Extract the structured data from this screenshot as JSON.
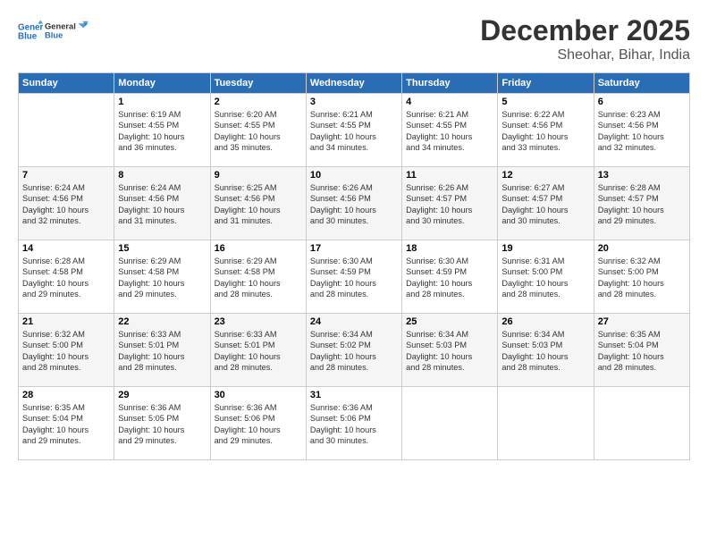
{
  "logo": {
    "line1": "General",
    "line2": "Blue"
  },
  "title": "December 2025",
  "subtitle": "Sheohar, Bihar, India",
  "header": {
    "days": [
      "Sunday",
      "Monday",
      "Tuesday",
      "Wednesday",
      "Thursday",
      "Friday",
      "Saturday"
    ]
  },
  "weeks": [
    [
      {
        "num": "",
        "info": ""
      },
      {
        "num": "1",
        "info": "Sunrise: 6:19 AM\nSunset: 4:55 PM\nDaylight: 10 hours\nand 36 minutes."
      },
      {
        "num": "2",
        "info": "Sunrise: 6:20 AM\nSunset: 4:55 PM\nDaylight: 10 hours\nand 35 minutes."
      },
      {
        "num": "3",
        "info": "Sunrise: 6:21 AM\nSunset: 4:55 PM\nDaylight: 10 hours\nand 34 minutes."
      },
      {
        "num": "4",
        "info": "Sunrise: 6:21 AM\nSunset: 4:55 PM\nDaylight: 10 hours\nand 34 minutes."
      },
      {
        "num": "5",
        "info": "Sunrise: 6:22 AM\nSunset: 4:56 PM\nDaylight: 10 hours\nand 33 minutes."
      },
      {
        "num": "6",
        "info": "Sunrise: 6:23 AM\nSunset: 4:56 PM\nDaylight: 10 hours\nand 32 minutes."
      }
    ],
    [
      {
        "num": "7",
        "info": "Sunrise: 6:24 AM\nSunset: 4:56 PM\nDaylight: 10 hours\nand 32 minutes."
      },
      {
        "num": "8",
        "info": "Sunrise: 6:24 AM\nSunset: 4:56 PM\nDaylight: 10 hours\nand 31 minutes."
      },
      {
        "num": "9",
        "info": "Sunrise: 6:25 AM\nSunset: 4:56 PM\nDaylight: 10 hours\nand 31 minutes."
      },
      {
        "num": "10",
        "info": "Sunrise: 6:26 AM\nSunset: 4:56 PM\nDaylight: 10 hours\nand 30 minutes."
      },
      {
        "num": "11",
        "info": "Sunrise: 6:26 AM\nSunset: 4:57 PM\nDaylight: 10 hours\nand 30 minutes."
      },
      {
        "num": "12",
        "info": "Sunrise: 6:27 AM\nSunset: 4:57 PM\nDaylight: 10 hours\nand 30 minutes."
      },
      {
        "num": "13",
        "info": "Sunrise: 6:28 AM\nSunset: 4:57 PM\nDaylight: 10 hours\nand 29 minutes."
      }
    ],
    [
      {
        "num": "14",
        "info": "Sunrise: 6:28 AM\nSunset: 4:58 PM\nDaylight: 10 hours\nand 29 minutes."
      },
      {
        "num": "15",
        "info": "Sunrise: 6:29 AM\nSunset: 4:58 PM\nDaylight: 10 hours\nand 29 minutes."
      },
      {
        "num": "16",
        "info": "Sunrise: 6:29 AM\nSunset: 4:58 PM\nDaylight: 10 hours\nand 28 minutes."
      },
      {
        "num": "17",
        "info": "Sunrise: 6:30 AM\nSunset: 4:59 PM\nDaylight: 10 hours\nand 28 minutes."
      },
      {
        "num": "18",
        "info": "Sunrise: 6:30 AM\nSunset: 4:59 PM\nDaylight: 10 hours\nand 28 minutes."
      },
      {
        "num": "19",
        "info": "Sunrise: 6:31 AM\nSunset: 5:00 PM\nDaylight: 10 hours\nand 28 minutes."
      },
      {
        "num": "20",
        "info": "Sunrise: 6:32 AM\nSunset: 5:00 PM\nDaylight: 10 hours\nand 28 minutes."
      }
    ],
    [
      {
        "num": "21",
        "info": "Sunrise: 6:32 AM\nSunset: 5:00 PM\nDaylight: 10 hours\nand 28 minutes."
      },
      {
        "num": "22",
        "info": "Sunrise: 6:33 AM\nSunset: 5:01 PM\nDaylight: 10 hours\nand 28 minutes."
      },
      {
        "num": "23",
        "info": "Sunrise: 6:33 AM\nSunset: 5:01 PM\nDaylight: 10 hours\nand 28 minutes."
      },
      {
        "num": "24",
        "info": "Sunrise: 6:34 AM\nSunset: 5:02 PM\nDaylight: 10 hours\nand 28 minutes."
      },
      {
        "num": "25",
        "info": "Sunrise: 6:34 AM\nSunset: 5:03 PM\nDaylight: 10 hours\nand 28 minutes."
      },
      {
        "num": "26",
        "info": "Sunrise: 6:34 AM\nSunset: 5:03 PM\nDaylight: 10 hours\nand 28 minutes."
      },
      {
        "num": "27",
        "info": "Sunrise: 6:35 AM\nSunset: 5:04 PM\nDaylight: 10 hours\nand 28 minutes."
      }
    ],
    [
      {
        "num": "28",
        "info": "Sunrise: 6:35 AM\nSunset: 5:04 PM\nDaylight: 10 hours\nand 29 minutes."
      },
      {
        "num": "29",
        "info": "Sunrise: 6:36 AM\nSunset: 5:05 PM\nDaylight: 10 hours\nand 29 minutes."
      },
      {
        "num": "30",
        "info": "Sunrise: 6:36 AM\nSunset: 5:06 PM\nDaylight: 10 hours\nand 29 minutes."
      },
      {
        "num": "31",
        "info": "Sunrise: 6:36 AM\nSunset: 5:06 PM\nDaylight: 10 hours\nand 30 minutes."
      },
      {
        "num": "",
        "info": ""
      },
      {
        "num": "",
        "info": ""
      },
      {
        "num": "",
        "info": ""
      }
    ]
  ]
}
